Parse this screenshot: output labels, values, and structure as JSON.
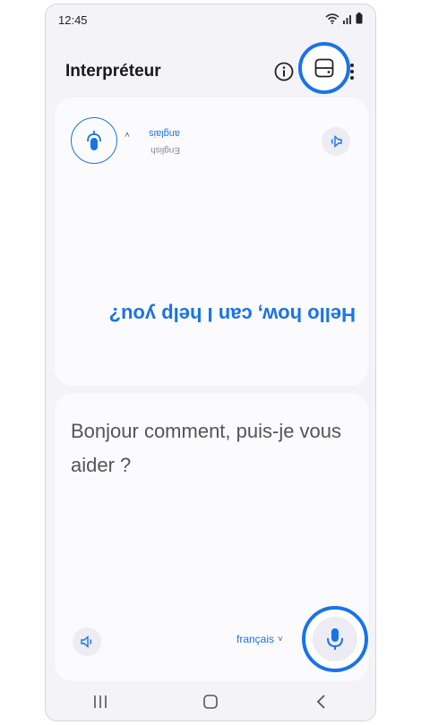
{
  "status_bar": {
    "time": "12:45",
    "icons": [
      "wifi-icon",
      "signal-icon",
      "battery-icon"
    ]
  },
  "app_bar": {
    "title": "Interpréteur",
    "actions": [
      "info-icon",
      "layout-icon",
      "more-vert-icon"
    ]
  },
  "top_panel": {
    "language_primary": "anglais",
    "language_secondary": "English",
    "text": "Hello how, can I help you?"
  },
  "bottom_panel": {
    "text": "Bonjour comment, puis-je vous aider ?",
    "language": "français"
  },
  "nav_bar": {
    "items": [
      "recents-icon",
      "home-icon",
      "back-icon"
    ]
  },
  "colors": {
    "accent": "#1a73e8",
    "background": "#f4f4f8",
    "card": "#fbfbfd"
  }
}
